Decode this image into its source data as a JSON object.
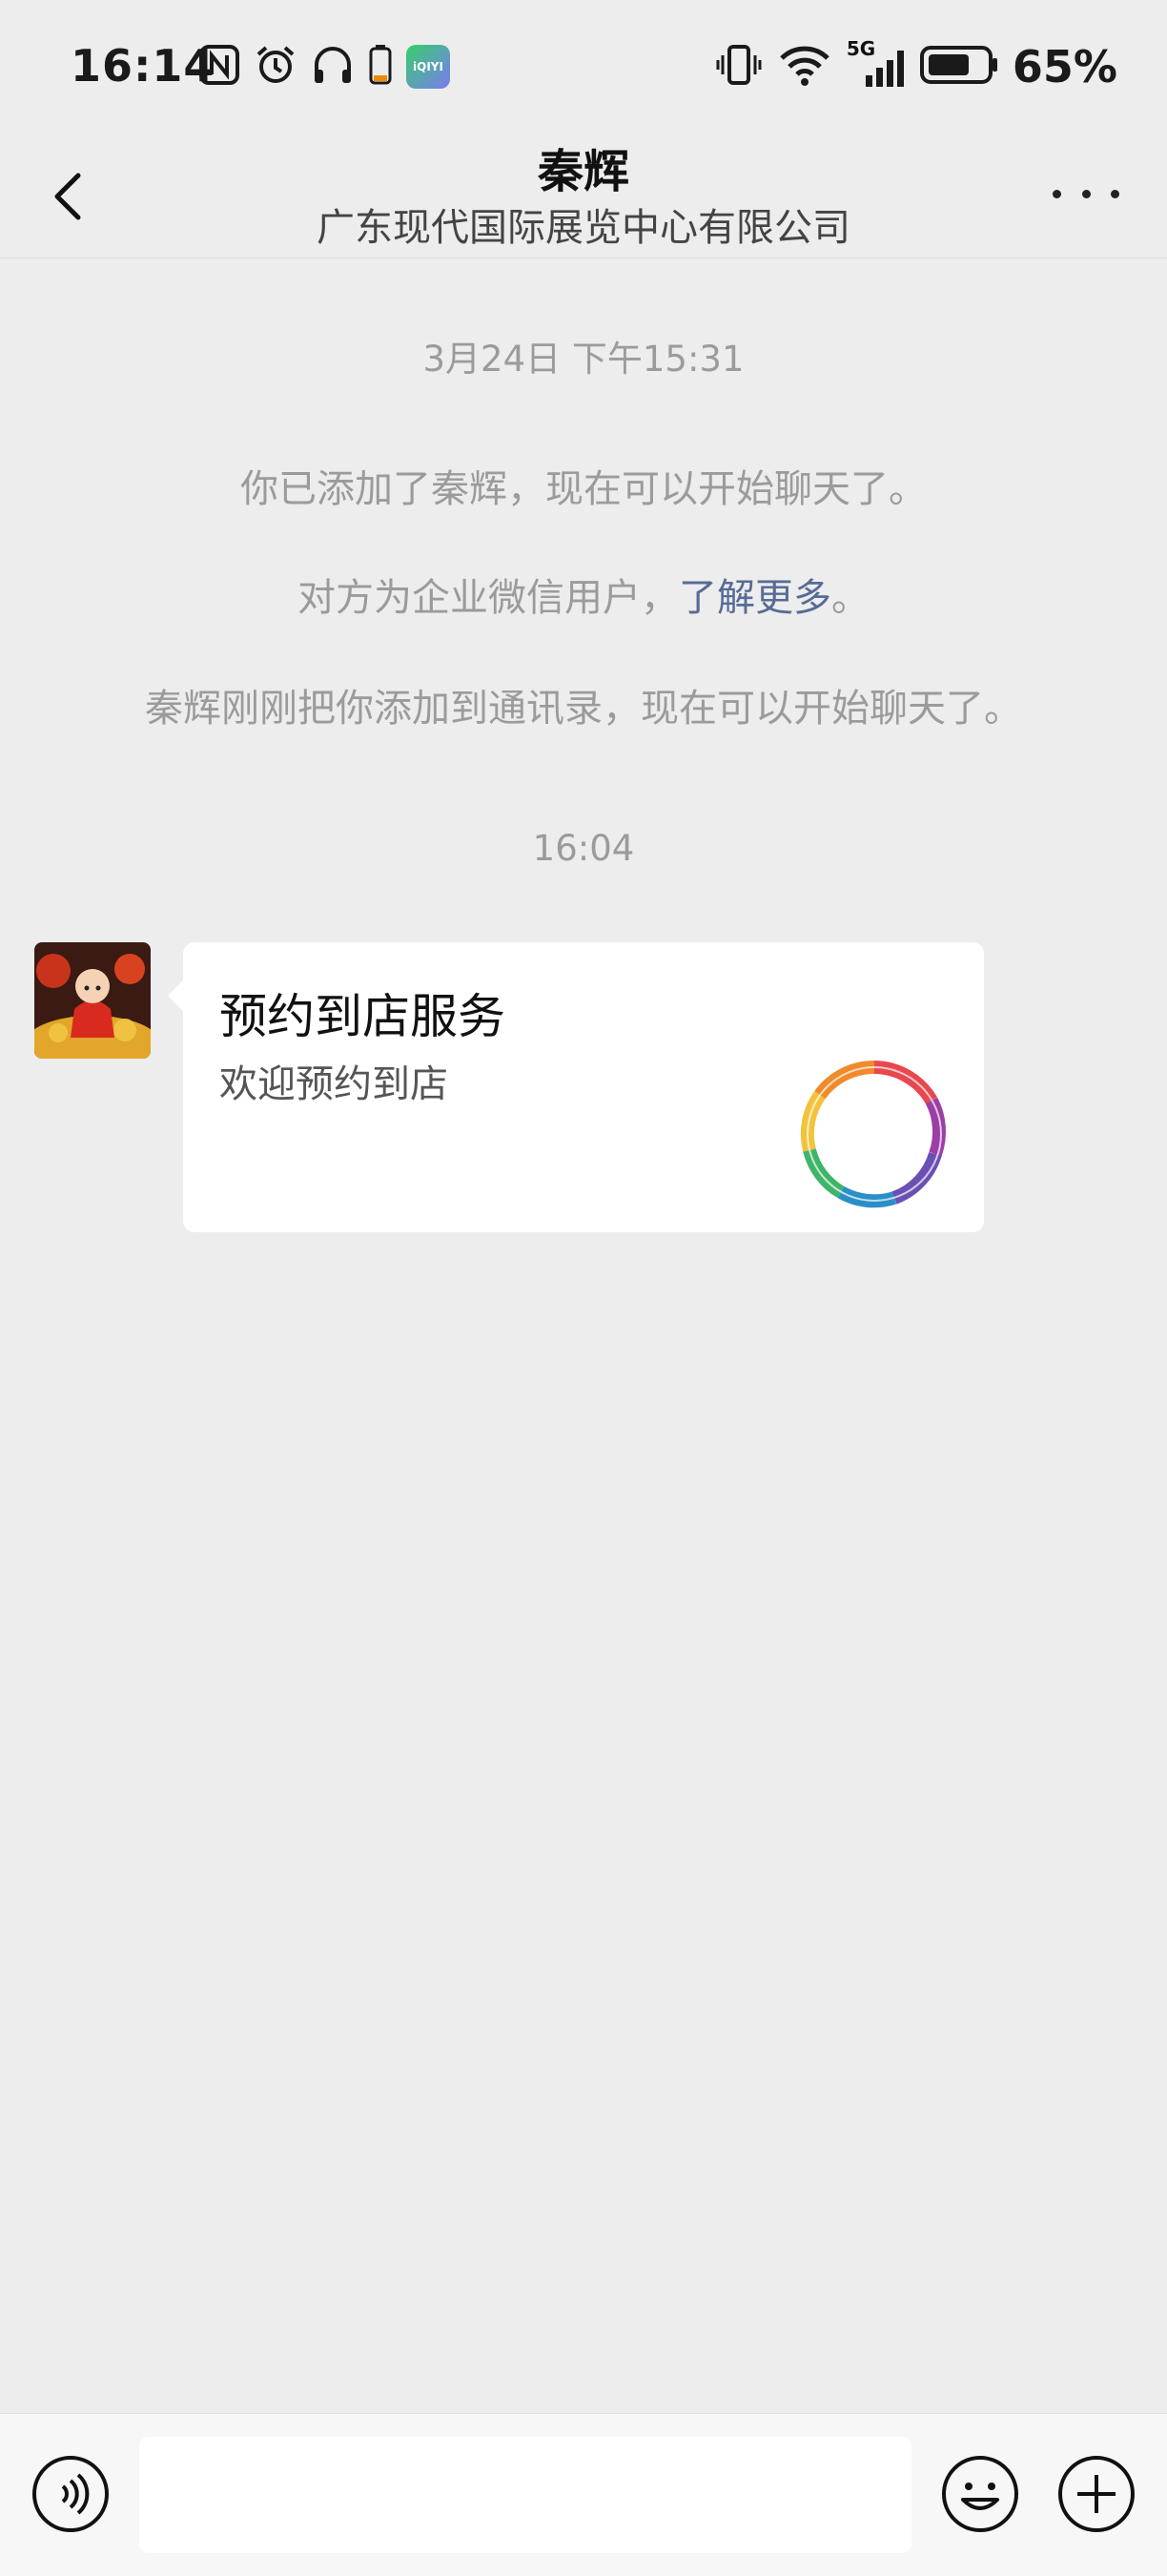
{
  "status_bar": {
    "time": "16:14",
    "network_label": "5G",
    "battery_percent": "65%",
    "icons": [
      "nfc-icon",
      "alarm-icon",
      "headphones-icon",
      "battery-small-icon",
      "iqiyi-app-icon",
      "vibrate-icon",
      "wifi-icon",
      "signal-icon",
      "battery-icon"
    ],
    "iqiyi_label": "iQIYI"
  },
  "header": {
    "title": "秦辉",
    "subtitle": "广东现代国际展览中心有限公司",
    "back_icon": "chevron-left-icon",
    "more_icon": "more-dots-icon"
  },
  "chat": {
    "timestamp_1": "3月24日 下午15:31",
    "system_1": "你已添加了秦辉，现在可以开始聊天了。",
    "system_2_prefix": "对方为企业微信用户，",
    "system_2_link": "了解更多",
    "system_2_suffix": "。",
    "system_3": "秦辉刚刚把你添加到通讯录，现在可以开始聊天了。",
    "timestamp_2": "16:04",
    "card": {
      "title": "预约到店服务",
      "description": "欢迎预约到店",
      "logo_icon": "colorful-ring-logo"
    }
  },
  "bottom_bar": {
    "input_value": "",
    "voice_icon": "voice-icon",
    "emoji_icon": "emoji-icon",
    "plus_icon": "plus-icon"
  }
}
